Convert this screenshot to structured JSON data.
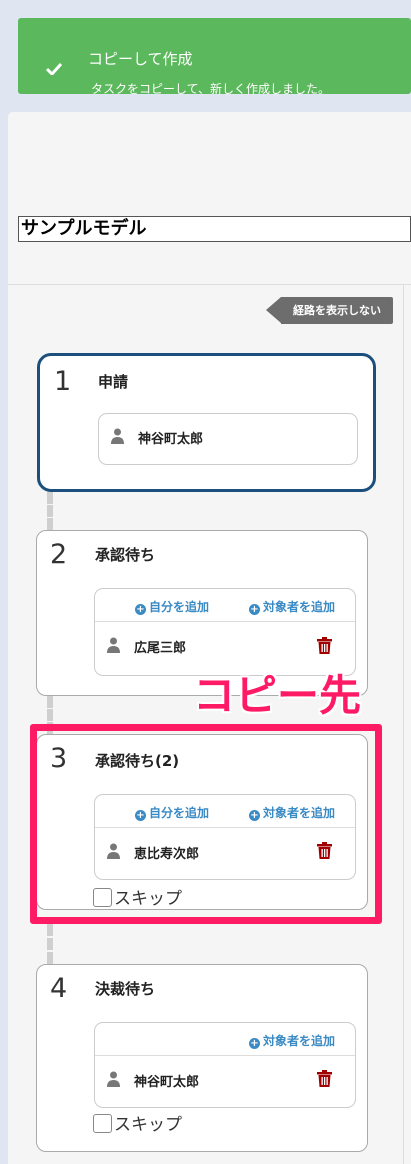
{
  "toast": {
    "title": "コピーして作成",
    "message": "タスクをコピーして、新しく作成しました。",
    "color": "#5cb85c",
    "icon": "check-icon"
  },
  "form": {
    "title_value": "サンプルモデル"
  },
  "route_toggle": {
    "label": "経路を表示しない"
  },
  "steps": [
    {
      "number": "1",
      "title": "申請",
      "approver": "神谷町太郎"
    },
    {
      "number": "2",
      "title": "承認待ち",
      "add_self": "自分を追加",
      "add_target": "対象者を追加",
      "approver": "広尾三郎"
    },
    {
      "number": "3",
      "title": "承認待ち(2)",
      "add_self": "自分を追加",
      "add_target": "対象者を追加",
      "approver": "恵比寿次郎",
      "skip": "スキップ"
    },
    {
      "number": "4",
      "title": "決裁待ち",
      "add_target": "対象者を追加",
      "approver": "神谷町太郎",
      "skip": "スキップ"
    }
  ],
  "annotation": {
    "label": "コピー先",
    "color": "#ff1a66"
  },
  "colors": {
    "active_border": "#1d4f7c",
    "link": "#3a8ac4",
    "trash": "#a00000"
  }
}
